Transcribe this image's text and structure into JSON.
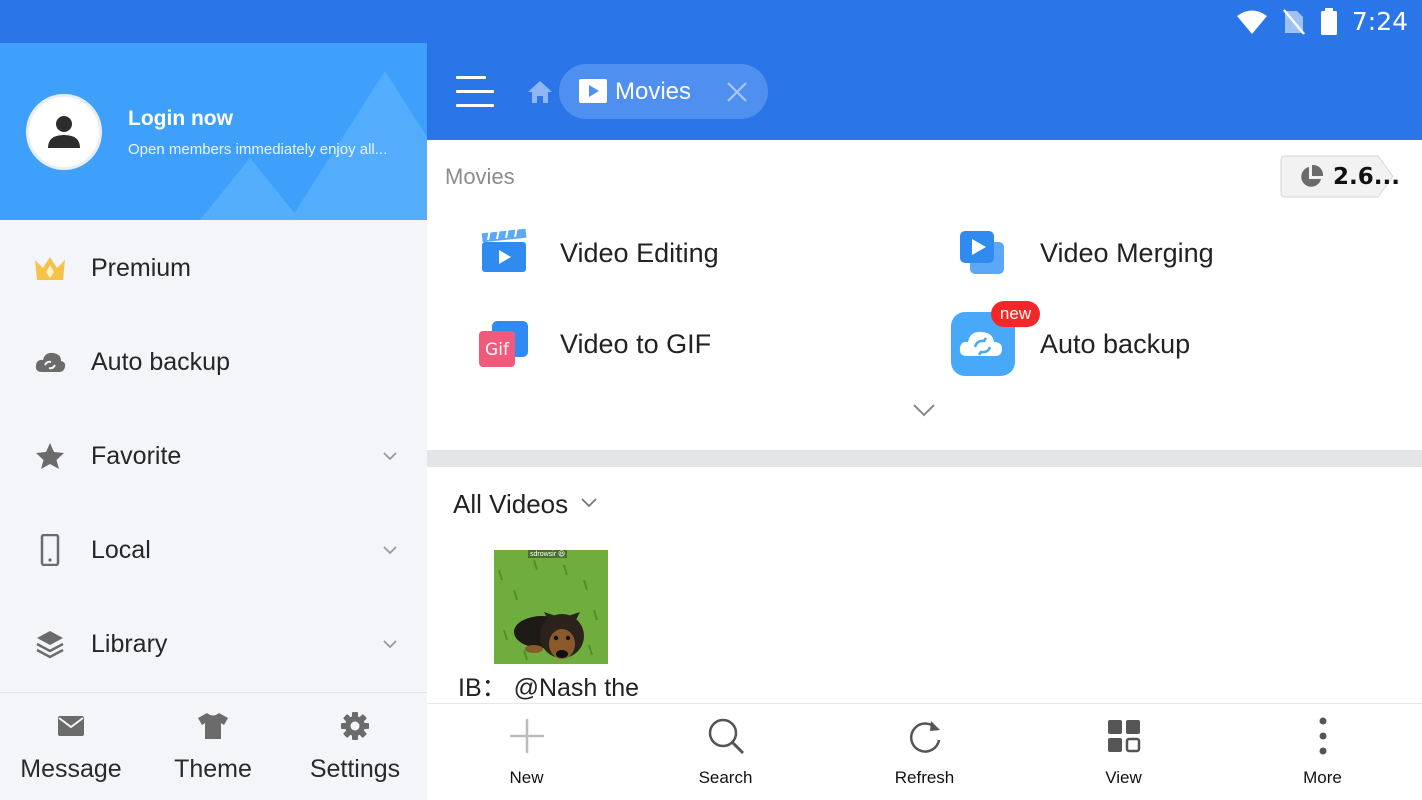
{
  "status_bar": {
    "time": "7:24"
  },
  "drawer": {
    "header": {
      "login_title": "Login now",
      "login_subtitle": "Open members immediately enjoy all..."
    },
    "items": [
      {
        "label": "Premium",
        "icon": "crown-icon",
        "expandable": false
      },
      {
        "label": "Auto backup",
        "icon": "cloud-sync-icon",
        "expandable": false
      },
      {
        "label": "Favorite",
        "icon": "star-icon",
        "expandable": true
      },
      {
        "label": "Local",
        "icon": "phone-icon",
        "expandable": true
      },
      {
        "label": "Library",
        "icon": "layers-icon",
        "expandable": true
      }
    ],
    "footer": [
      {
        "label": "Message",
        "icon": "envelope-icon"
      },
      {
        "label": "Theme",
        "icon": "shirt-icon"
      },
      {
        "label": "Settings",
        "icon": "gear-icon"
      }
    ]
  },
  "topbar": {
    "tab_label": "Movies"
  },
  "content": {
    "title": "Movies",
    "storage_label": "2.6...",
    "tools": [
      {
        "label": "Video Editing",
        "icon": "video-editing-icon"
      },
      {
        "label": "Video Merging",
        "icon": "video-merging-icon"
      },
      {
        "label": "Video to GIF",
        "icon": "gif-icon",
        "icon_text": "Gif"
      },
      {
        "label": "Auto backup",
        "icon": "cloud-backup-icon"
      }
    ],
    "new_badge": "new",
    "section_title": "All Videos",
    "videos": [
      {
        "caption": "IB： @Nash the",
        "thumb_text": "sdrowsir 😃"
      }
    ]
  },
  "bottom_bar": [
    {
      "label": "New",
      "icon": "plus-icon"
    },
    {
      "label": "Search",
      "icon": "search-icon"
    },
    {
      "label": "Refresh",
      "icon": "refresh-icon"
    },
    {
      "label": "View",
      "icon": "grid-view-icon"
    },
    {
      "label": "More",
      "icon": "more-vertical-icon"
    }
  ],
  "colors": {
    "primary": "#2a76e8",
    "drawer_header": "#3fa0fb",
    "badge_red": "#f32727"
  }
}
